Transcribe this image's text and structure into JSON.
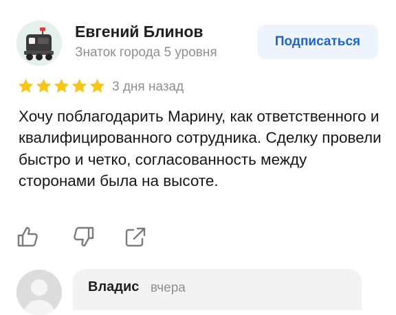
{
  "author": {
    "name": "Евгений Блинов",
    "status": "Знаток города 5 уровня",
    "subscribe_label": "Подписаться"
  },
  "rating": {
    "value": 5,
    "max": 5,
    "color": "#f5c518",
    "date": "3 дня назад"
  },
  "review": {
    "text": "Хочу поблагодарить Марину, как ответственного и квалифицированного сотрудника. Сделку провели быстро и четко, согласованность между сторонами была на высоте."
  },
  "actions": {
    "icons": [
      "thumbs-up-icon",
      "thumbs-down-icon",
      "share-icon"
    ]
  },
  "reply": {
    "name": "Владис",
    "date": "вчера"
  },
  "colors": {
    "accent": "#2164c7",
    "button_bg": "#eef4fb",
    "muted": "#8f8f8f"
  }
}
